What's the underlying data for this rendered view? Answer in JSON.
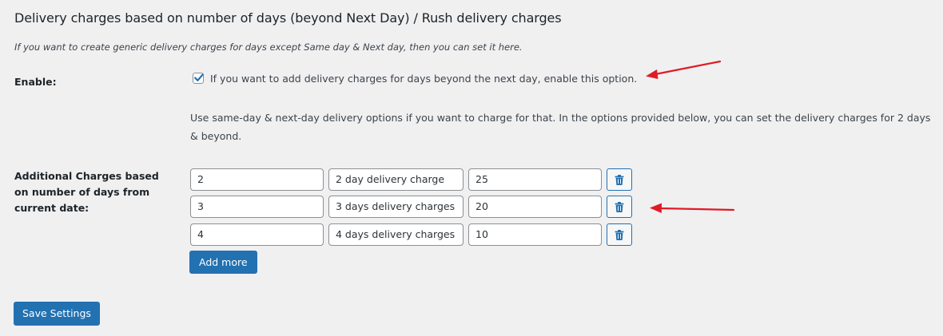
{
  "section": {
    "title": "Delivery charges based on number of days (beyond Next Day) / Rush delivery charges",
    "description": "If you want to create generic delivery charges for days except Same day & Next day, then you can set it here."
  },
  "enable": {
    "label": "Enable:",
    "checked": true,
    "checkbox_text": "If you want to add delivery charges for days beyond the next day, enable this option.",
    "help_text": "Use same-day & next-day delivery options if you want to charge for that. In the options provided below, you can set the delivery charges for 2 days & beyond."
  },
  "charges": {
    "label": "Additional Charges based on number of days from current date:",
    "rows": [
      {
        "days": "2",
        "label": "2 day delivery charge",
        "amount": "25"
      },
      {
        "days": "3",
        "label": "3 days delivery charges",
        "amount": "20"
      },
      {
        "days": "4",
        "label": "4 days delivery charges",
        "amount": "10"
      }
    ],
    "delete_icon": "trash-icon",
    "add_more_label": "Add more"
  },
  "footer": {
    "save_label": "Save Settings"
  },
  "colors": {
    "primary": "#2271b1",
    "annotation_arrow": "#e01b24",
    "background": "#f0f0f1"
  }
}
